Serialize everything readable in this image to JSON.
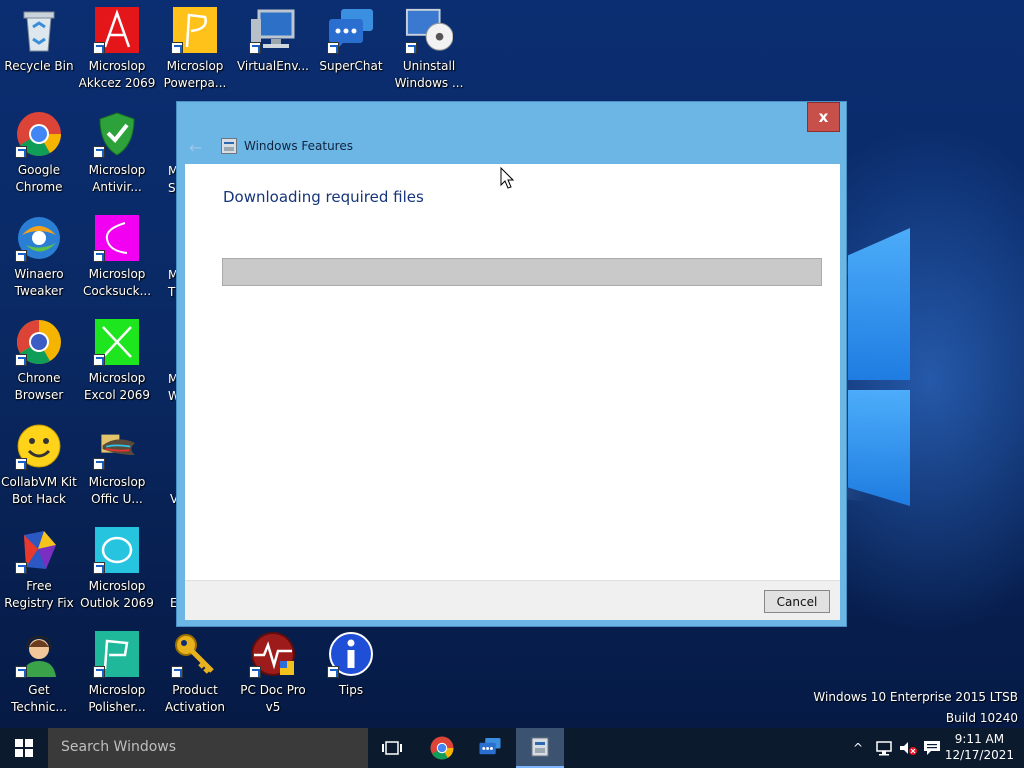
{
  "desktop": {
    "icons": [
      {
        "label": "Recycle Bin",
        "icon": "recycle-bin-icon"
      },
      {
        "label": "Microslop\nAkkcez 2069",
        "icon": "access-icon"
      },
      {
        "label": "Microslop\nPowerpa...",
        "icon": "powerpoint-icon"
      },
      {
        "label": "VirtualEnv...",
        "icon": "computer-icon"
      },
      {
        "label": "SuperChat",
        "icon": "chat-icon"
      },
      {
        "label": "Uninstall\nWindows ...",
        "icon": "uninstall-icon"
      },
      {
        "label": "Google\nChrome",
        "icon": "chrome-icon"
      },
      {
        "label": "Microslop\nAntivir...",
        "icon": "shield-icon"
      },
      {
        "label": "Winaero\nTweaker",
        "icon": "winaero-icon"
      },
      {
        "label": "Microslop\nCocksuck...",
        "icon": "pink-app-icon"
      },
      {
        "label": "Chrone\nBrowser",
        "icon": "chrome-icon"
      },
      {
        "label": "Microslop\nExcol 2069",
        "icon": "excel-icon"
      },
      {
        "label": "CollabVM Kit\nBot Hack",
        "icon": "smiley-icon"
      },
      {
        "label": "Microslop\nOffic U...",
        "icon": "folder-fish-icon"
      },
      {
        "label": "Free\nRegistry Fix",
        "icon": "registry-fix-icon"
      },
      {
        "label": "Microslop\nOutlok 2069",
        "icon": "outlook-icon"
      },
      {
        "label": "Get\nTechnic...",
        "icon": "support-agent-icon"
      },
      {
        "label": "Microslop\nPolisher...",
        "icon": "publisher-icon"
      },
      {
        "label": "Product\nActivation",
        "icon": "key-icon"
      },
      {
        "label": "PC Doc Pro\nv5",
        "icon": "pc-doc-icon"
      },
      {
        "label": "Tips",
        "icon": "info-icon"
      }
    ],
    "partial_labels": [
      "M",
      "S",
      "M",
      "T",
      "M",
      "W",
      "V",
      "E"
    ]
  },
  "dialog": {
    "title": "Windows Features",
    "heading": "Downloading required files",
    "progress_fraction": 0,
    "cancel_label": "Cancel",
    "close_glyph": "x",
    "back_glyph": "←"
  },
  "watermark": {
    "line1": "Windows 10 Enterprise 2015 LTSB",
    "line2": "Build 10240"
  },
  "taskbar": {
    "search_placeholder": "Search Windows",
    "time": "9:11 AM",
    "date": "12/17/2021",
    "tray_chevron": "^"
  },
  "colors": {
    "titlebar": "#6cb6e6",
    "close_button": "#c7504a",
    "heading_text": "#16357a",
    "taskbar": "#0c1a2e",
    "search_box": "#3a3a3a"
  }
}
